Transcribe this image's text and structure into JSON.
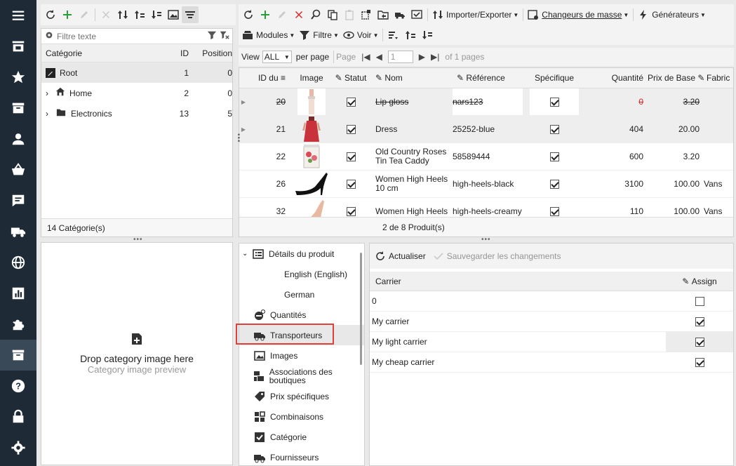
{
  "nav": {
    "items": [
      {
        "name": "menu-icon"
      },
      {
        "name": "store-icon"
      },
      {
        "name": "star-icon"
      },
      {
        "name": "inbox-icon"
      },
      {
        "name": "user-icon"
      },
      {
        "name": "basket-icon"
      },
      {
        "name": "comment-icon"
      },
      {
        "name": "truck-icon"
      },
      {
        "name": "globe-icon"
      },
      {
        "name": "chart-icon"
      },
      {
        "name": "puzzle-icon"
      },
      {
        "name": "catalog-icon"
      },
      {
        "name": "help-icon"
      },
      {
        "name": "lock-icon"
      },
      {
        "name": "settings-icon"
      }
    ]
  },
  "category": {
    "filter_placeholder": "Filtre texte",
    "headers": {
      "name": "Catégorie",
      "id": "ID",
      "position": "Position"
    },
    "rows": [
      {
        "name": "Root",
        "id": "1",
        "position": "0"
      },
      {
        "name": "Home",
        "id": "2",
        "position": "0"
      },
      {
        "name": "Electronics",
        "id": "13",
        "position": "5"
      }
    ],
    "footer": "14 Catégorie(s)"
  },
  "drop": {
    "title": "Drop category image here",
    "subtitle": "Category image preview"
  },
  "products_toolbar": {
    "import_export": "Importer/Exporter",
    "mass_changers": "Changeurs de masse",
    "generators": "Générateurs",
    "modules": "Modules",
    "filter": "Filtre",
    "view": "Voir"
  },
  "pager": {
    "view_label": "View",
    "view_value": "ALL",
    "per_page": "per page",
    "page_label": "Page",
    "page_value": "1",
    "of_pages": "of 1 pages"
  },
  "products": {
    "headers": {
      "id": "ID du",
      "image": "Image",
      "statut": "Statut",
      "nom": "Nom",
      "reference": "Référence",
      "specifique": "Spécifique",
      "quantite": "Quantité",
      "prix": "Prix de Base",
      "fabric": "Fabric"
    },
    "rows": [
      {
        "id": "20",
        "nom": "Lip gloss",
        "ref": "nars123",
        "qty": "0",
        "price": "3.20",
        "fab": ""
      },
      {
        "id": "21",
        "nom": "Dress",
        "ref": "25252-blue",
        "qty": "404",
        "price": "20.00",
        "fab": ""
      },
      {
        "id": "22",
        "nom": "Old Country Roses Tin Tea Caddy",
        "ref": "58589444",
        "qty": "600",
        "price": "3.20",
        "fab": ""
      },
      {
        "id": "26",
        "nom": "Women High Heels 10 cm",
        "ref": "high-heels-black",
        "qty": "3100",
        "price": "100.00",
        "fab": "Vans"
      },
      {
        "id": "32",
        "nom": "Women High Heels",
        "ref": "high-heels-creamy",
        "qty": "110",
        "price": "100.00",
        "fab": "Vans"
      }
    ],
    "footer": "2 de 8 Produit(s)"
  },
  "details": {
    "items": [
      {
        "label": "Détails du produit"
      },
      {
        "label": "English (English)"
      },
      {
        "label": "German"
      },
      {
        "label": "Quantités"
      },
      {
        "label": "Transporteurs"
      },
      {
        "label": "Images"
      },
      {
        "label": "Associations des boutiques"
      },
      {
        "label": "Prix spécifiques"
      },
      {
        "label": "Combinaisons"
      },
      {
        "label": "Catégorie"
      },
      {
        "label": "Fournisseurs"
      }
    ]
  },
  "carriers": {
    "refresh": "Actualiser",
    "save": "Sauvegarder les changements",
    "headers": {
      "carrier": "Carrier",
      "assign": "Assign"
    },
    "rows": [
      {
        "name": "0",
        "assigned": false
      },
      {
        "name": "My carrier",
        "assigned": true
      },
      {
        "name": "My light carrier",
        "assigned": true
      },
      {
        "name": "My cheap carrier",
        "assigned": true
      }
    ]
  },
  "colors": {
    "nav_bg": "#1e2a36",
    "highlight_box": "#e0403a",
    "deleted_red": "#d22"
  }
}
